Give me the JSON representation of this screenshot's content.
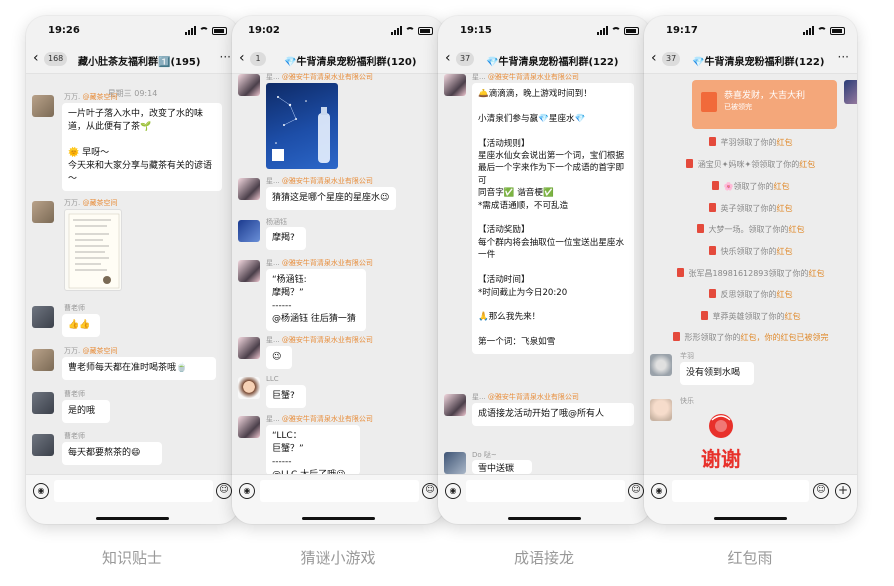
{
  "screens": [
    {
      "status": {
        "time": "19:26"
      },
      "nav": {
        "badge": "168",
        "title": "藏小肚茶友福利群1️⃣(195)"
      },
      "timestamp": "星期三 09:14",
      "messages": [
        {
          "sender": "万万.",
          "sender_org": "@藏茶空间",
          "text": "一片叶子落入水中，改变了水的味道，从此便有了茶🌱\n\n🌞 早呀～\n今天来和大家分享与藏茶有关的谚语～"
        },
        {
          "sender": "万万.",
          "sender_org": "@藏茶空间",
          "image": "handwritten-note"
        },
        {
          "sender": "曹老师",
          "text": "👍👍"
        },
        {
          "sender": "万万.",
          "sender_org": "@藏茶空间",
          "text": "曹老师每天都在准时喝茶哦🍵"
        },
        {
          "sender": "曹老师",
          "text": "是的哦"
        },
        {
          "sender": "曹老师",
          "text": "每天都要熬茶的😄"
        }
      ],
      "caption": "知识贴士"
    },
    {
      "status": {
        "time": "19:02"
      },
      "nav": {
        "badge": "1",
        "title": "💎牛背清泉宠粉福利群(120)"
      },
      "messages": [
        {
          "sender": "星...",
          "sender_org": "@雅安牛背清泉水业有限公司",
          "image": "constellation-bottle"
        },
        {
          "sender": "星...",
          "sender_org": "@雅安牛背清泉水业有限公司",
          "text": "猜猜这是哪个星座的星座水😉"
        },
        {
          "sender": "杨涵钰",
          "text": "摩羯?"
        },
        {
          "sender": "星...",
          "sender_org": "@雅安牛背清泉水业有限公司",
          "text": "“杨涵钰:\n摩羯？”\n------\n@杨涵钰 往后猜一猜"
        },
        {
          "sender": "星...",
          "sender_org": "@雅安牛背清泉水业有限公司",
          "text": "😉"
        },
        {
          "sender": "LLC",
          "text": "巨蟹?"
        },
        {
          "sender": "星...",
          "sender_org": "@雅安牛背清泉水业有限公司",
          "text": "“LLC：\n巨蟹？”\n------\n@LLC  太后了哦😉"
        }
      ],
      "caption": "猜谜小游戏"
    },
    {
      "status": {
        "time": "19:15"
      },
      "nav": {
        "badge": "37",
        "title": "💎牛背清泉宠粉福利群(122)"
      },
      "messages": [
        {
          "sender": "星...",
          "sender_org": "@雅安牛背清泉水业有限公司",
          "text": "🛎️滴滴滴，晚上游戏时间到！\n\n小清泉们参与赢💎星座水💎\n\n【活动规则】\n星座水仙女会说出第一个词，宝们根据最后一个字来作为下一个成语的首字即可\n同音字✅ 谐音梗✅\n*需成语通顺，不可乱造\n\n【活动奖励】\n每个群内将会抽取位一位宝送出星座水一件\n\n【活动时间】\n*时间截止为今日20:20\n\n🙏那么我先来！\n\n第一个词：飞泉如雪"
        },
        {
          "sender": "星...",
          "sender_org": "@雅安牛背清泉水业有限公司",
          "text": "成语接龙活动开始了哦@所有人"
        },
        {
          "sender": "Do 哒~",
          "text": "雪中送碳"
        }
      ],
      "caption": "成语接龙"
    },
    {
      "status": {
        "time": "19:17"
      },
      "nav": {
        "badge": "37",
        "title": "💎牛背清泉宠粉福利群(122)"
      },
      "red_packet": {
        "title": "恭喜发财，大吉大利",
        "sub": "已被领完",
        "label": "微信红包"
      },
      "system_lines": [
        {
          "name": "芊羽",
          "text": "领取了你的",
          "suffix": "红包"
        },
        {
          "name": "涵宝贝✦妈咪✦领",
          "text": "领取了你的",
          "suffix": "红包"
        },
        {
          "name": "🌸",
          "text": "领取了你的",
          "suffix": "红包"
        },
        {
          "name": "英子",
          "text": "领取了你的",
          "suffix": "红包"
        },
        {
          "name": "大梦一场。",
          "text": "领取了你的",
          "suffix": "红包"
        },
        {
          "name": "快乐",
          "text": "领取了你的",
          "suffix": "红包"
        },
        {
          "name": "张军昌18981612893",
          "text": "领取了你的",
          "suffix": "红包"
        },
        {
          "name": "反思",
          "text": "领取了你的",
          "suffix": "红包"
        },
        {
          "name": "草莽英雄",
          "text": "领取了你的",
          "suffix": "红包"
        },
        {
          "name": "形形",
          "text": "领取了你的",
          "suffix": "红包，你的红包已被领完"
        }
      ],
      "messages": [
        {
          "sender": "芊羽",
          "text": "没有领到水喝"
        },
        {
          "sender": "快乐",
          "sticker": "谢谢"
        }
      ],
      "caption": "红包雨"
    }
  ],
  "icons": {
    "voice": "voice-icon",
    "emoji": "emoji-icon",
    "plus": "plus-icon",
    "back": "back-arrow-icon",
    "more": "more-icon"
  }
}
